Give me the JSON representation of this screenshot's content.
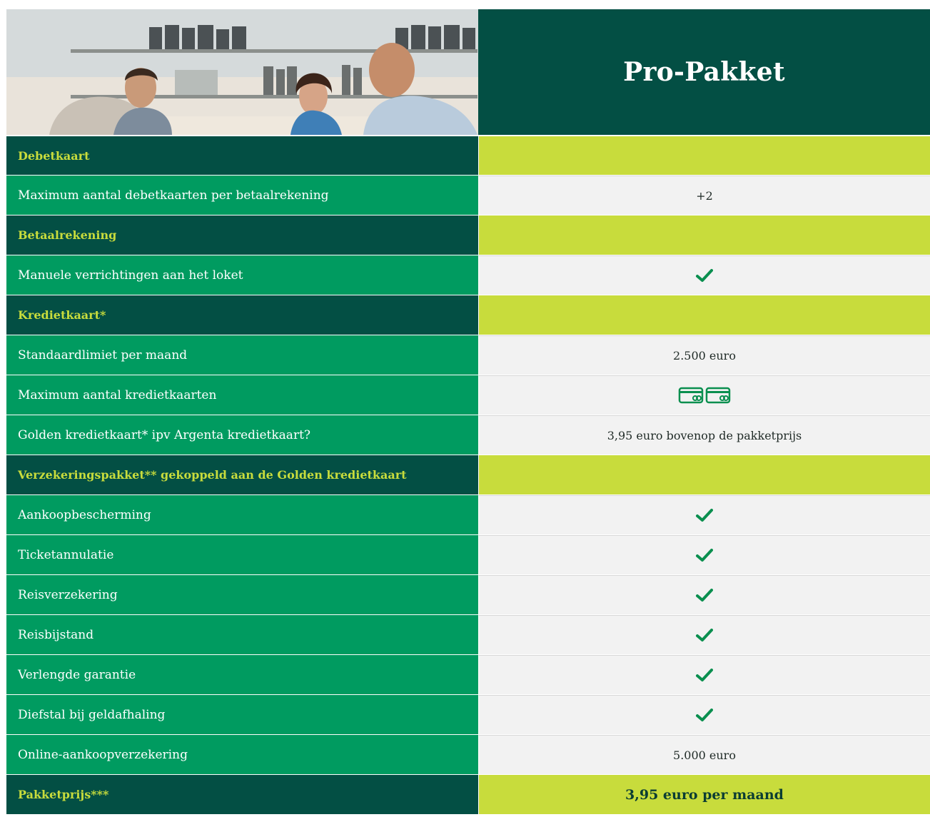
{
  "header": {
    "photo_alt": "Kantoorgesprek",
    "plan_title": "Pro-Pakket"
  },
  "rows": [
    {
      "type": "section",
      "label": "Debetkaart",
      "value": ""
    },
    {
      "type": "item",
      "label": "Maximum aantal debetkaarten per betaalrekening",
      "value": "+2"
    },
    {
      "type": "section",
      "label": "Betaalrekening",
      "value": ""
    },
    {
      "type": "item",
      "label": "Manuele verrichtingen aan het loket",
      "value": "",
      "icon": "check-icon"
    },
    {
      "type": "section",
      "label": "Kredietkaart*",
      "value": ""
    },
    {
      "type": "item",
      "label": "Standaardlimiet per maand",
      "value": "2.500 euro"
    },
    {
      "type": "item",
      "label": "Maximum aantal kredietkaarten",
      "value": "",
      "icon": "credit-cards-icon"
    },
    {
      "type": "item",
      "label": "Golden kredietkaart* ipv Argenta kredietkaart?",
      "value": "3,95 euro bovenop de pakketprijs"
    },
    {
      "type": "section",
      "label": "Verzekeringspakket** gekoppeld aan de Golden kredietkaart",
      "value": ""
    },
    {
      "type": "item",
      "label": "Aankoopbescherming",
      "value": "",
      "icon": "check-icon"
    },
    {
      "type": "item",
      "label": "Ticketannulatie",
      "value": "",
      "icon": "check-icon"
    },
    {
      "type": "item",
      "label": "Reisverzekering",
      "value": "",
      "icon": "check-icon"
    },
    {
      "type": "item",
      "label": "Reisbijstand",
      "value": "",
      "icon": "check-icon"
    },
    {
      "type": "item",
      "label": "Verlengde garantie",
      "value": "",
      "icon": "check-icon"
    },
    {
      "type": "item",
      "label": "Diefstal bij geldafhaling",
      "value": "",
      "icon": "check-icon"
    },
    {
      "type": "item",
      "label": "Online-aankoopverzekering",
      "value": "5.000 euro"
    },
    {
      "type": "price",
      "label": "Pakketprijs***",
      "value": "3,95 euro per maand"
    }
  ],
  "colors": {
    "dark_green": "#034f44",
    "mid_green": "#009b60",
    "lime": "#c8dc3c",
    "light_grey": "#f2f2f2",
    "check_green": "#0a8f4f"
  }
}
